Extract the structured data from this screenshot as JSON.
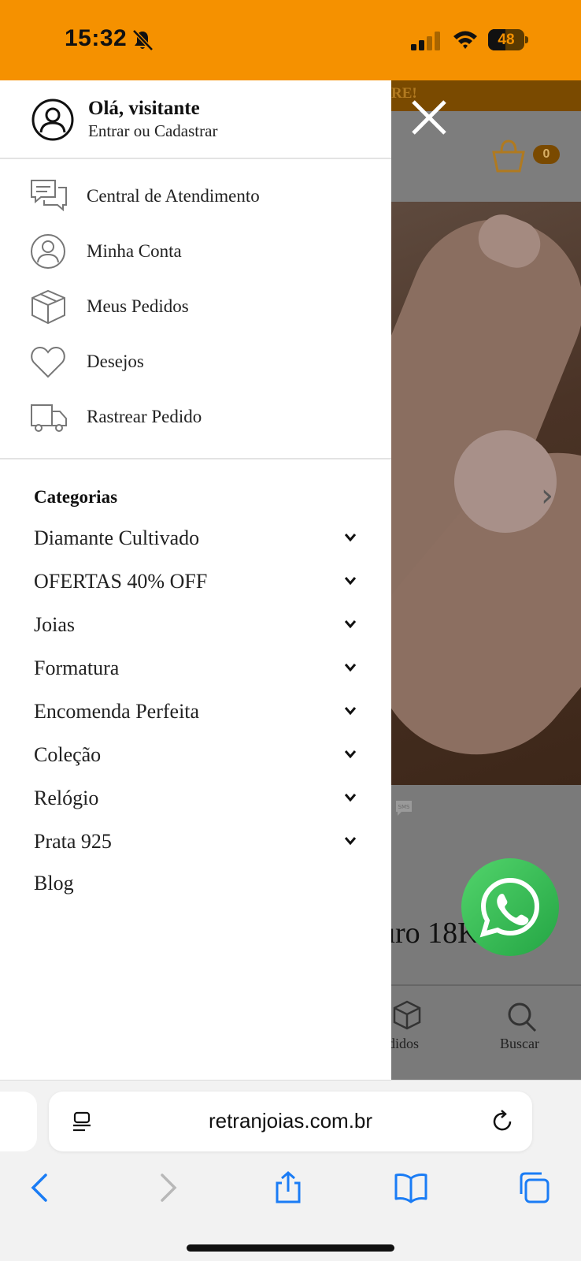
{
  "status_bar": {
    "time": "15:32",
    "battery": "48",
    "battery_level": 0.48,
    "icons": [
      "bell-slash-icon",
      "signal-icon",
      "wifi-icon",
      "battery-icon"
    ]
  },
  "background_page": {
    "banner_text": "RE!",
    "cart_count": "0",
    "product_title_fragment": "uro 18K",
    "nav_pedidos": "edidos",
    "nav_buscar": "Buscar"
  },
  "drawer": {
    "greeting": "Olá, visitante",
    "login_link": "Entrar ou Cadastrar",
    "menu_items": [
      {
        "label": "Central de Atendimento",
        "icon": "chat-icon"
      },
      {
        "label": "Minha Conta",
        "icon": "user-icon"
      },
      {
        "label": "Meus Pedidos",
        "icon": "box-icon"
      },
      {
        "label": "Desejos",
        "icon": "heart-icon"
      },
      {
        "label": "Rastrear Pedido",
        "icon": "truck-icon"
      }
    ],
    "categories_title": "Categorias",
    "categories": [
      {
        "label": "Diamante Cultivado",
        "has_submenu": true
      },
      {
        "label": "OFERTAS 40% OFF",
        "has_submenu": true
      },
      {
        "label": "Joias",
        "has_submenu": true
      },
      {
        "label": "Formatura",
        "has_submenu": true
      },
      {
        "label": "Encomenda Perfeita",
        "has_submenu": true
      },
      {
        "label": "Coleção",
        "has_submenu": true
      },
      {
        "label": "Relógio",
        "has_submenu": true
      },
      {
        "label": "Prata 925",
        "has_submenu": true
      },
      {
        "label": "Blog",
        "has_submenu": false
      }
    ]
  },
  "browser": {
    "url": "retranjoias.com.br",
    "toolbar": [
      "back-icon",
      "forward-icon",
      "share-icon",
      "bookmarks-icon",
      "tabs-icon"
    ]
  },
  "colors": {
    "status_bar": "#f59100",
    "accent_link": "#1a7cf5",
    "whatsapp": "#25d366"
  }
}
